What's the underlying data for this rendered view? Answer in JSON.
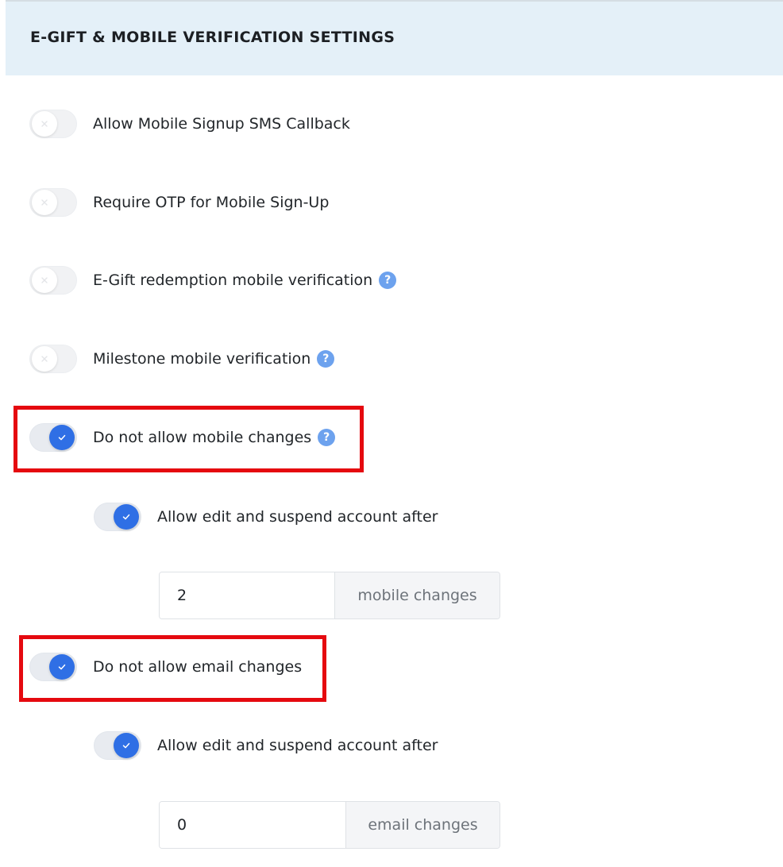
{
  "section": {
    "title": "E-GIFT & MOBILE VERIFICATION SETTINGS"
  },
  "settings": [
    {
      "label": "Allow Mobile Signup SMS Callback",
      "enabled": false,
      "help": false
    },
    {
      "label": "Require OTP for Mobile Sign-Up",
      "enabled": false,
      "help": false
    },
    {
      "label": "E-Gift redemption mobile verification",
      "enabled": false,
      "help": true
    },
    {
      "label": "Milestone mobile verification",
      "enabled": false,
      "help": true
    },
    {
      "label": "Do not allow mobile changes",
      "enabled": true,
      "help": true
    }
  ],
  "mobile_sub": {
    "label": "Allow edit and suspend account after",
    "enabled": true,
    "value": "2",
    "unit": "mobile changes"
  },
  "email": {
    "label": "Do not allow email changes",
    "enabled": true
  },
  "email_sub": {
    "label": "Allow edit and suspend account after",
    "enabled": true,
    "value": "0",
    "unit": "email changes"
  },
  "help_glyph": "?",
  "colors": {
    "header_bg": "#e4f0f8",
    "toggle_on": "#2f6fe5",
    "help_icon": "#6da2ee",
    "highlight": "#e5090f"
  }
}
